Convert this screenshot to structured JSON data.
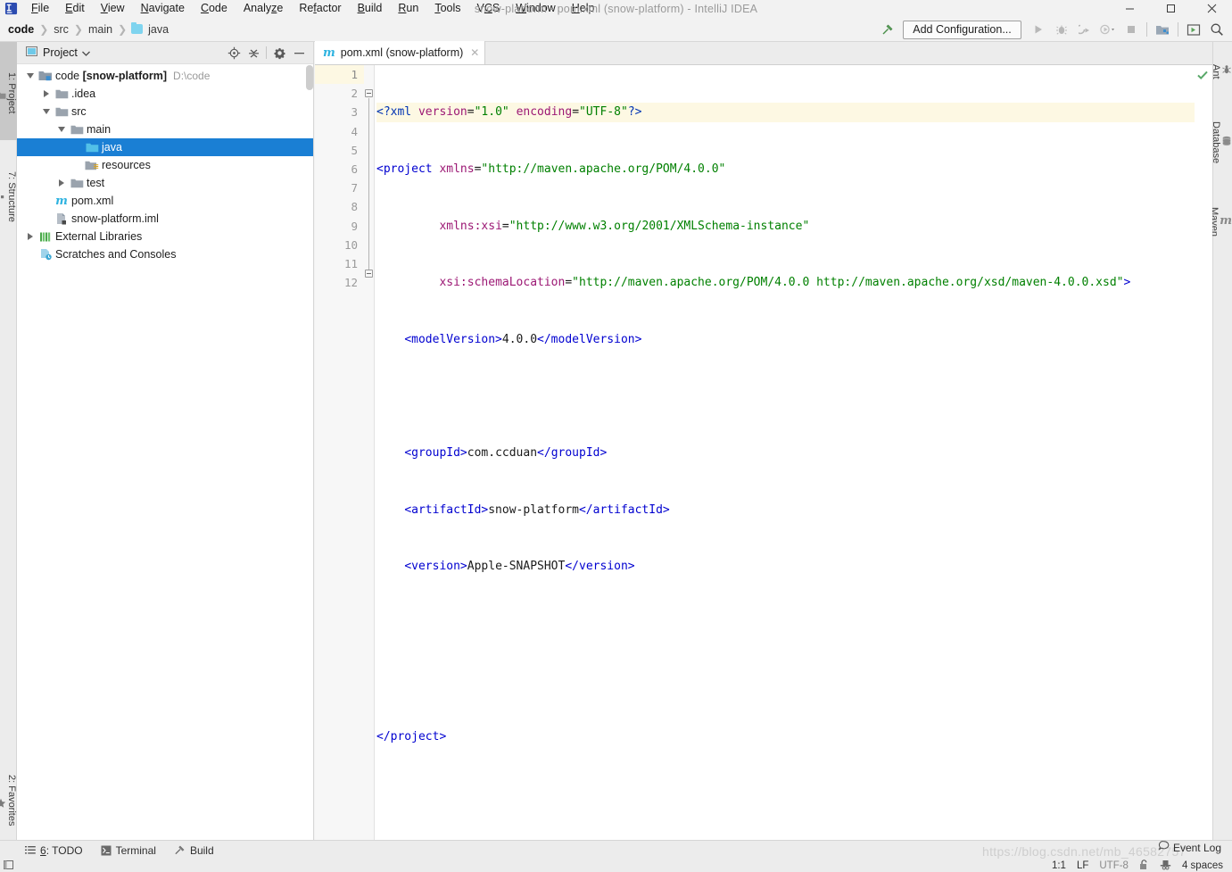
{
  "window": {
    "title": "snow-platform - pom.xml (snow-platform) - IntelliJ IDEA",
    "minimize": "—",
    "maximize": "☐",
    "close": "✕"
  },
  "menubar": {
    "items": [
      {
        "label": "File",
        "mnemonic": "F"
      },
      {
        "label": "Edit",
        "mnemonic": "E"
      },
      {
        "label": "View",
        "mnemonic": "V"
      },
      {
        "label": "Navigate",
        "mnemonic": "N"
      },
      {
        "label": "Code",
        "mnemonic": "C"
      },
      {
        "label": "Analyze",
        "mnemonic": "A"
      },
      {
        "label": "Refactor",
        "mnemonic": "R"
      },
      {
        "label": "Build",
        "mnemonic": "B"
      },
      {
        "label": "Run",
        "mnemonic": "R"
      },
      {
        "label": "Tools",
        "mnemonic": "T"
      },
      {
        "label": "VCS",
        "mnemonic": "V"
      },
      {
        "label": "Window",
        "mnemonic": "W"
      },
      {
        "label": "Help",
        "mnemonic": "H"
      }
    ]
  },
  "breadcrumb": {
    "items": [
      "code",
      "src",
      "main",
      "java"
    ],
    "separator": "〉"
  },
  "toolbar": {
    "add_configuration": "Add Configuration...",
    "icons": [
      "build-hammer-icon",
      "run-icon",
      "debug-icon",
      "run-with-coverage-icon",
      "profile-icon",
      "stop-icon",
      "project-structure-icon",
      "update-project-icon",
      "search-everywhere-icon"
    ]
  },
  "left_strip": {
    "project": "1: Project",
    "structure": "7: Structure",
    "favorites": "2: Favorites"
  },
  "right_strip": {
    "items": [
      "Ant",
      "Database",
      "Maven"
    ]
  },
  "project_panel": {
    "title": "Project",
    "header_icons": [
      "locate-target-icon",
      "collapse-all-icon",
      "settings-gear-icon",
      "hide-panel-icon"
    ],
    "tree": [
      {
        "label": "code",
        "bold_part": "[snow-platform]",
        "path": "D:\\code",
        "icon": "module-folder-icon",
        "indent": 0,
        "twisty": "down"
      },
      {
        "label": ".idea",
        "icon": "folder-icon",
        "indent": 1,
        "twisty": "right"
      },
      {
        "label": "src",
        "icon": "folder-icon",
        "indent": 1,
        "twisty": "down"
      },
      {
        "label": "main",
        "icon": "folder-icon",
        "indent": 2,
        "twisty": "down"
      },
      {
        "label": "java",
        "icon": "source-root-folder-icon",
        "indent": 3,
        "twisty": "none",
        "selected": true
      },
      {
        "label": "resources",
        "icon": "resource-root-folder-icon",
        "indent": 3,
        "twisty": "none"
      },
      {
        "label": "test",
        "icon": "folder-icon",
        "indent": 2,
        "twisty": "right"
      },
      {
        "label": "pom.xml",
        "icon": "maven-pom-icon",
        "indent": 1,
        "twisty": "none"
      },
      {
        "label": "snow-platform.iml",
        "icon": "iml-module-icon",
        "indent": 1,
        "twisty": "none"
      },
      {
        "label": "External Libraries",
        "icon": "libraries-icon",
        "indent": 0,
        "twisty": "right"
      },
      {
        "label": "Scratches and Consoles",
        "icon": "scratches-icon",
        "indent": 0,
        "twisty": "none"
      }
    ]
  },
  "editor": {
    "tab": {
      "label": "pom.xml (snow-platform)",
      "icon": "maven-pom-icon",
      "close": "✕"
    },
    "inspection_status": "ok-check-icon",
    "line_numbers": [
      1,
      2,
      3,
      4,
      5,
      6,
      7,
      8,
      9,
      10,
      11,
      12
    ],
    "current_line": 1,
    "lines": [
      "<?xml version=\"1.0\" encoding=\"UTF-8\"?>",
      "<project xmlns=\"http://maven.apache.org/POM/4.0.0\"",
      "         xmlns:xsi=\"http://www.w3.org/2001/XMLSchema-instance\"",
      "         xsi:schemaLocation=\"http://maven.apache.org/POM/4.0.0 http://maven.apache.org/xsd/maven-4.0.0.xsd\">",
      "    <modelVersion>4.0.0</modelVersion>",
      "",
      "    <groupId>com.ccduan</groupId>",
      "    <artifactId>snow-platform</artifactId>",
      "    <version>Apple-SNAPSHOT</version>",
      "",
      "",
      "</project>"
    ]
  },
  "bottom_bar": {
    "items": [
      {
        "label": "6: TODO",
        "mnemonic": "6",
        "icon": "todo-list-icon"
      },
      {
        "label": "Terminal",
        "icon": "terminal-icon"
      },
      {
        "label": "Build",
        "icon": "build-hammer-icon"
      }
    ],
    "event_log": "Event Log"
  },
  "status_bar": {
    "caret_position": "1:1",
    "line_separator": "LF",
    "encoding": "UTF-8",
    "lock_icon": "unlocked-padlock-icon",
    "inspection_icon": "inspector-hat-icon",
    "indent": "4 spaces"
  },
  "watermark": "https://blog.csdn.net/mb_46582757",
  "colors": {
    "selection_blue": "#1a7fd4",
    "folder_blue": "#7fd4ef",
    "xml_tag": "#0033b3",
    "xml_attr": "#9c1874",
    "xml_string": "#008000",
    "accent_green": "#59a869"
  }
}
